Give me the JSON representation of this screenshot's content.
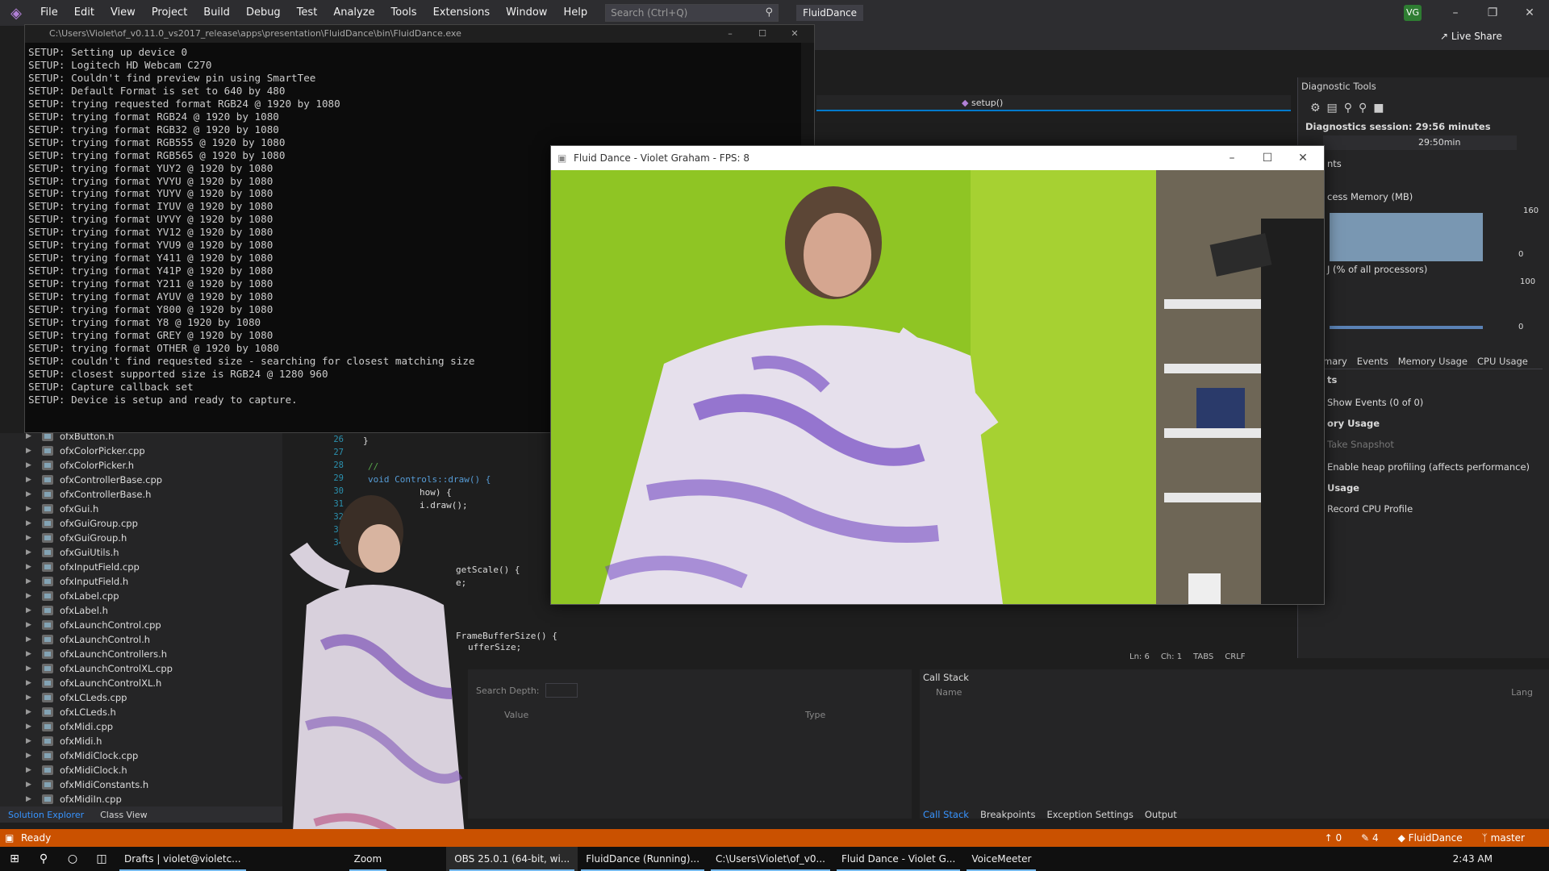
{
  "menubar": {
    "items": [
      "File",
      "Edit",
      "View",
      "Project",
      "Build",
      "Debug",
      "Test",
      "Analyze",
      "Tools",
      "Extensions",
      "Window",
      "Help"
    ],
    "search_placeholder": "Search (Ctrl+Q)",
    "solution_name": "FluidDance",
    "avatar_initials": "VG",
    "live_share": "Live Share"
  },
  "console": {
    "title": "C:\\Users\\Violet\\of_v0.11.0_vs2017_release\\apps\\presentation\\FluidDance\\bin\\FluidDance.exe",
    "lines": [
      "SETUP: Setting up device 0",
      "SETUP: Logitech HD Webcam C270",
      "SETUP: Couldn't find preview pin using SmartTee",
      "SETUP: Default Format is set to 640 by 480",
      "SETUP: trying requested format RGB24 @ 1920 by 1080",
      "SETUP: trying format RGB24 @ 1920 by 1080",
      "SETUP: trying format RGB32 @ 1920 by 1080",
      "SETUP: trying format RGB555 @ 1920 by 1080",
      "SETUP: trying format RGB565 @ 1920 by 1080",
      "SETUP: trying format YUY2 @ 1920 by 1080",
      "SETUP: trying format YVYU @ 1920 by 1080",
      "SETUP: trying format YUYV @ 1920 by 1080",
      "SETUP: trying format IYUV @ 1920 by 1080",
      "SETUP: trying format UYVY @ 1920 by 1080",
      "SETUP: trying format YV12 @ 1920 by 1080",
      "SETUP: trying format YVU9 @ 1920 by 1080",
      "SETUP: trying format Y411 @ 1920 by 1080",
      "SETUP: trying format Y41P @ 1920 by 1080",
      "SETUP: trying format Y211 @ 1920 by 1080",
      "SETUP: trying format AYUV @ 1920 by 1080",
      "SETUP: trying format Y800 @ 1920 by 1080",
      "SETUP: trying format Y8 @ 1920 by 1080",
      "SETUP: trying format GREY @ 1920 by 1080",
      "SETUP: trying format OTHER @ 1920 by 1080",
      "SETUP: couldn't find requested size - searching for closest matching size",
      "SETUP: closest supported size is RGB24 @ 1280 960",
      "SETUP: Capture callback set",
      "SETUP: Device is setup and ready to capture."
    ]
  },
  "solution_explorer": {
    "files": [
      "ofxButton.h",
      "ofxColorPicker.cpp",
      "ofxColorPicker.h",
      "ofxControllerBase.cpp",
      "ofxControllerBase.h",
      "ofxGui.h",
      "ofxGuiGroup.cpp",
      "ofxGuiGroup.h",
      "ofxGuiUtils.h",
      "ofxInputField.cpp",
      "ofxInputField.h",
      "ofxLabel.cpp",
      "ofxLabel.h",
      "ofxLaunchControl.cpp",
      "ofxLaunchControl.h",
      "ofxLaunchControllers.h",
      "ofxLaunchControlXL.cpp",
      "ofxLaunchControlXL.h",
      "ofxLCLeds.cpp",
      "ofxLCLeds.h",
      "ofxMidi.cpp",
      "ofxMidi.h",
      "ofxMidiClock.cpp",
      "ofxMidiClock.h",
      "ofxMidiConstants.h",
      "ofxMidiIn.cpp"
    ],
    "tabs": [
      "Solution Explorer",
      "Class View"
    ]
  },
  "editor": {
    "line_numbers": [
      "26",
      "27",
      "28",
      "29",
      "30",
      "31",
      "32",
      "33",
      "34"
    ],
    "function_dropdown": "setup()",
    "code_lines": [
      "}",
      "",
      "//",
      "void Controls::draw() {",
      "how) {",
      "i.draw();"
    ],
    "code_lower": [
      "getScale() {",
      "e;",
      "}",
      "FrameBufferSize() {",
      "ufferSize;"
    ],
    "status": {
      "ln": "Ln: 6",
      "ch": "Ch: 1",
      "tabs": "TABS",
      "crlf": "CRLF"
    }
  },
  "diagnostics": {
    "title": "Diagnostic Tools",
    "session": "Diagnostics session: 29:56 minutes",
    "timeline_label": "29:50min",
    "events_label": "nts",
    "memory_label": "cess Memory (MB)",
    "memory_max": "160",
    "memory_min": "0",
    "cpu_label": "J (% of all processors)",
    "cpu_max": "100",
    "cpu_min": "0",
    "tabs": [
      "mary",
      "Events",
      "Memory Usage",
      "CPU Usage"
    ],
    "events_heading": "ts",
    "show_events": "Show Events (0 of 0)",
    "memory_usage_heading": "ory Usage",
    "take_snapshot": "Take Snapshot",
    "heap_profiling": "Enable heap profiling (affects performance)",
    "cpu_usage_heading": "Usage",
    "record_cpu": "Record CPU Profile"
  },
  "fluid_window": {
    "title": "Fluid Dance - Violet Graham - FPS: 8"
  },
  "locals": {
    "search_depth_label": "Search Depth:",
    "col_value": "Value",
    "col_type": "Type"
  },
  "callstack": {
    "title": "Call Stack",
    "col_name": "Name",
    "col_lang": "Lang",
    "tabs": [
      "Call Stack",
      "Breakpoints",
      "Exception Settings",
      "Output"
    ]
  },
  "statusbar": {
    "ready": "Ready",
    "up_count": "0",
    "edit_count": "4",
    "repo": "FluidDance",
    "branch": "master"
  },
  "taskbar": {
    "apps": [
      "Drafts | violet@violetc...",
      "Zoom",
      "OBS 25.0.1 (64-bit, wi...",
      "FluidDance (Running)...",
      "C:\\Users\\Violet\\of_v0...",
      "Fluid Dance - Violet G...",
      "VoiceMeeter"
    ],
    "time": "2:43 AM"
  },
  "colors": {
    "accent": "#007acc",
    "statusbar": "#ca5100",
    "green_screen": "#9ad12a"
  }
}
